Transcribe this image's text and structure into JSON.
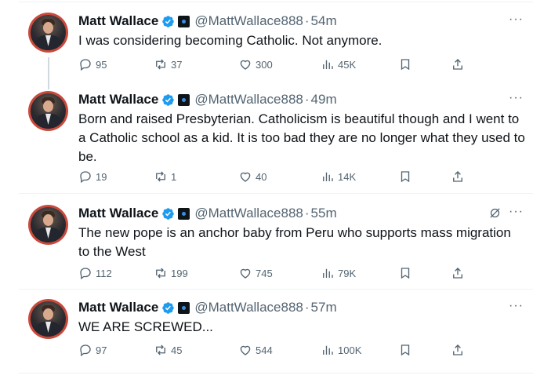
{
  "tweets": [
    {
      "name": "Matt Wallace",
      "handle": "@MattWallace888",
      "dot": "·",
      "time": "54m",
      "text": "I was considering becoming Catholic. Not anymore.",
      "replies": "95",
      "reposts": "37",
      "likes": "300",
      "views": "45K"
    },
    {
      "name": "Matt Wallace",
      "handle": "@MattWallace888",
      "dot": "·",
      "time": "49m",
      "text": "Born and raised Presbyterian. Catholicism is beautiful though and I went to a Catholic school as a kid. It is too bad they are no longer what they used to be.",
      "replies": "19",
      "reposts": "1",
      "likes": "40",
      "views": "14K"
    },
    {
      "name": "Matt Wallace",
      "handle": "@MattWallace888",
      "dot": "·",
      "time": "55m",
      "text": "The new pope is an anchor baby from Peru who supports mass migration to the West",
      "replies": "112",
      "reposts": "199",
      "likes": "745",
      "views": "79K"
    },
    {
      "name": "Matt Wallace",
      "handle": "@MattWallace888",
      "dot": "·",
      "time": "57m",
      "text": "WE ARE SCREWED...",
      "replies": "97",
      "reposts": "45",
      "likes": "544",
      "views": "100K"
    }
  ],
  "more_label": "···",
  "colors": {
    "verified": "#1d9bf0",
    "muted": "#536471",
    "text": "#0f1419",
    "avatar_ring": "#c94a3c"
  },
  "icons": [
    "reply-icon",
    "repost-icon",
    "like-icon",
    "views-icon",
    "bookmark-icon",
    "share-icon",
    "verified-badge-icon",
    "grok-icon",
    "more-icon"
  ]
}
